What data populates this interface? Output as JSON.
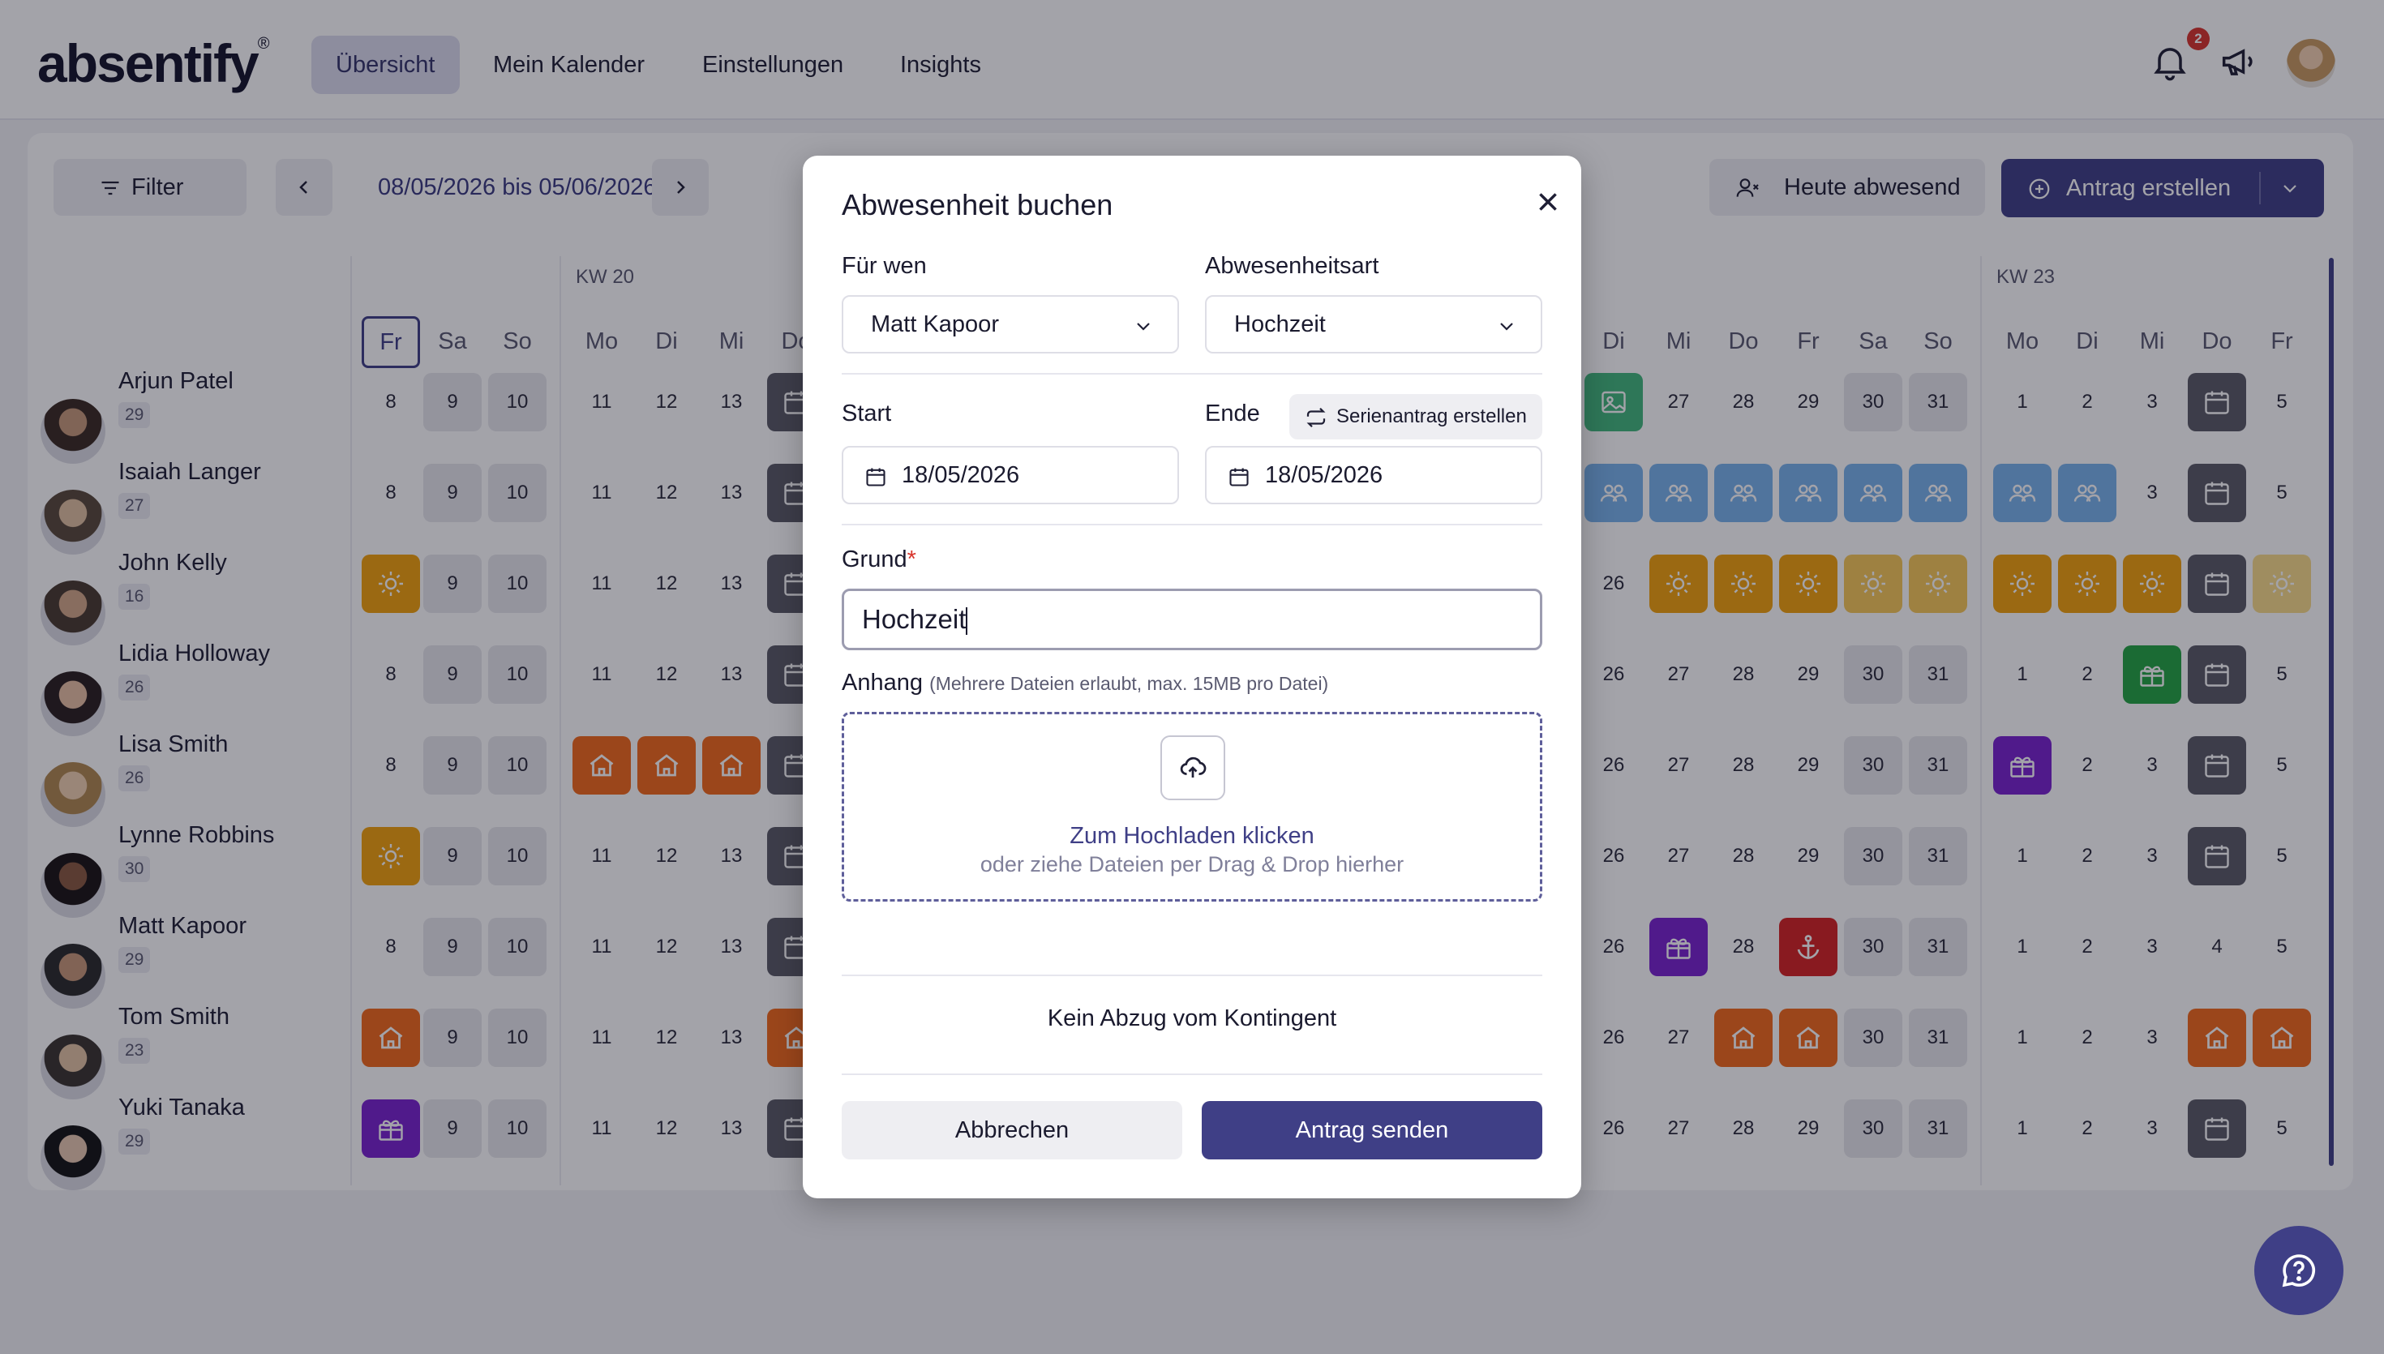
{
  "app": {
    "logo": "absentify",
    "logo_mark": "®",
    "nav": {
      "tab1": "Übersicht",
      "tab2": "Mein Kalender",
      "tab3": "Einstellungen",
      "tab4": "Insights"
    },
    "notification_count": "2"
  },
  "toolbar": {
    "filter_label": "Filter",
    "date_range": "08/05/2026 bis 05/06/2026",
    "today_absent_label": "Heute abwesend",
    "create_request_label": "Antrag erstellen"
  },
  "calendar": {
    "week_labels": {
      "kw20": "KW 20",
      "kw23": "KW 23"
    },
    "day_headers": [
      "Fr",
      "Sa",
      "So",
      "Mo",
      "Di",
      "Mi",
      "Do",
      "Di",
      "Mi",
      "Do",
      "Fr",
      "Sa",
      "So",
      "Mo",
      "Di",
      "Mi",
      "Do",
      "Fr"
    ],
    "people": [
      {
        "name": "Arjun Patel",
        "count": "29"
      },
      {
        "name": "Isaiah Langer",
        "count": "27"
      },
      {
        "name": "John Kelly",
        "count": "16"
      },
      {
        "name": "Lidia Holloway",
        "count": "26"
      },
      {
        "name": "Lisa Smith",
        "count": "26"
      },
      {
        "name": "Lynne Robbins",
        "count": "30"
      },
      {
        "name": "Matt Kapoor",
        "count": "29"
      },
      {
        "name": "Tom Smith",
        "count": "23"
      },
      {
        "name": "Yuki Tanaka",
        "count": "29"
      }
    ],
    "left_dates": [
      "8",
      "9",
      "10",
      "11",
      "12",
      "13"
    ],
    "right_dates": [
      "26",
      "27",
      "28",
      "29",
      "30",
      "31",
      "1",
      "2",
      "3",
      "4",
      "5"
    ],
    "colors": {
      "vacation": "#f2a20c",
      "home_office": "#f26a1b",
      "team": "#7ab3ec",
      "special": "#7a22cf",
      "holiday_green": "#25a543",
      "anchor": "#d62222",
      "calendar_dark": "#5b5b66"
    }
  },
  "modal": {
    "title": "Abwesenheit buchen",
    "for_whom_label": "Für wen",
    "for_whom_value": "Matt Kapoor",
    "type_label": "Abwesenheitsart",
    "type_value": "Hochzeit",
    "start_label": "Start",
    "end_label": "Ende",
    "series_label": "Serienantrag erstellen",
    "start_value": "18/05/2026",
    "end_value": "18/05/2026",
    "reason_label": "Grund",
    "reason_required": "*",
    "reason_value": "Hochzeit",
    "attachment_label": "Anhang",
    "attachment_hint": "(Mehrere Dateien erlaubt, max. 15MB pro Datei)",
    "upload_link": "Zum Hochladen klicken",
    "upload_sub": "oder ziehe Dateien per Drag & Drop hierher",
    "note": "Kein Abzug vom Kontingent",
    "cancel_label": "Abbrechen",
    "send_label": "Antrag senden"
  },
  "accent": "#3f3f86"
}
